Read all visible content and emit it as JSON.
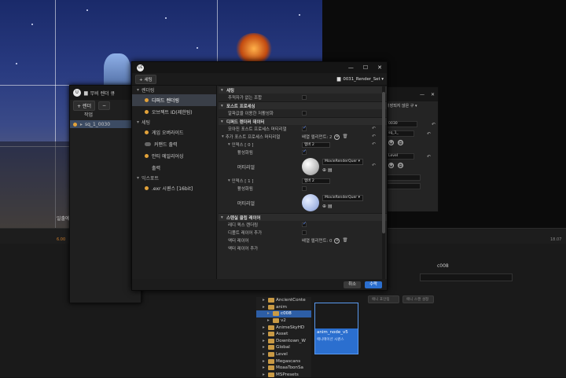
{
  "viewport": {
    "label": "일출예"
  },
  "timeline": {
    "left_num": "6.00",
    "right_num": "18.07"
  },
  "sequence_window": {
    "title": "무비 렌더 큐",
    "render_button": "+ 렌더",
    "column_header": "작업",
    "job_name": "sq_1_0030"
  },
  "settings_window": {
    "title_suffix": "저장되지 않은 구 ▾",
    "field1": "0030",
    "field2": "sq_1_",
    "field3": "Level"
  },
  "content_browser": {
    "folders": [
      "AncientConte",
      "anim",
      "c008",
      "v2",
      "AnimeSkyHD",
      "Asset",
      "Downtown_W",
      "Global",
      "Level",
      "Megascans",
      "MoaaToonSa",
      "MSPresets"
    ],
    "asset_name": "anim_node_v5",
    "asset_type": "애니메이션 시퀀스",
    "selected_name": "c008",
    "btn_a": "애니 포인팅",
    "btn_b": "애니 스캔 설정"
  },
  "dialog": {
    "title_logo": "UE",
    "add_setting": "+ 세팅",
    "preset_name": "0031_Render_Set ▾",
    "sidebar": {
      "categories": [
        {
          "label": "렌더링",
          "items": [
            {
              "label": "디퍼드 렌더링",
              "selected": true,
              "dot": "orange"
            },
            {
              "label": "오브젝트 ID(제한됨)",
              "selected": false,
              "dot": "orange"
            }
          ]
        },
        {
          "label": "세팅",
          "items": [
            {
              "label": "게임 오버라이드",
              "selected": false,
              "dot": "orange"
            },
            {
              "label": "커맨드 출력",
              "selected": false,
              "dot": "gray"
            },
            {
              "label": "안티 에일리어싱",
              "selected": false,
              "dot": "orange"
            },
            {
              "label": "출력",
              "selected": false,
              "dot": "none"
            }
          ]
        },
        {
          "label": "익스포트",
          "items": [
            {
              "label": ".exr 시퀀스 [16bit]",
              "selected": false,
              "dot": "orange"
            }
          ]
        }
      ]
    },
    "sections": {
      "basic": "세팅",
      "basic_prop": "추적자가 없는 조합",
      "post": "포스트 프로세싱",
      "post_prop": "알파값을 이용한 저활성화",
      "deferred": "디퍼드 렌더러 데이터",
      "deferred_prop1": "모아진 포스트 프로세스 머티리얼",
      "deferred_prop2": "추가 포스트 프로세스 머티리얼",
      "array_count": "배열 엘리먼트: 2",
      "index0_label": "인덱스 [ 0 ]",
      "index0_members": "멤버 2",
      "enabled_label": "활성화됨",
      "material_label": "머티리얼",
      "material_value": "MovieRenderQuer",
      "index1_label": "인덱스 [ 1 ]",
      "index1_members": "멤버 2",
      "stencil": "스텐실 클립 레이어",
      "stencil_prop1": "레디 퀵스 렌더링",
      "stencil_prop2": "디폴트 레이어 추가",
      "stencil_prop3": "액터 레이어",
      "stencil_count": "배열 엘리먼트: 0",
      "stencil_prop4": "액터 레이어 추가"
    },
    "cancel": "취소",
    "accept": "수락"
  },
  "misc": {
    "c008_label": "c008"
  },
  "colors": {
    "accent": "#2b6fcf",
    "orange_dot": "#e2a23a"
  }
}
